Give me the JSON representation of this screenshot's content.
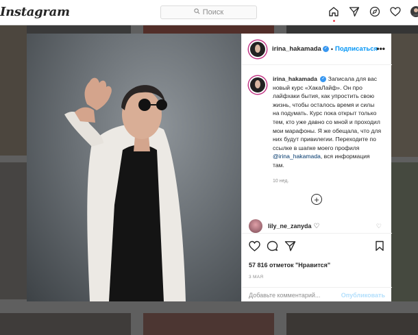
{
  "app": {
    "logo": "Instagram"
  },
  "header": {
    "search": {
      "placeholder": "Поиск"
    },
    "icons": [
      "home-icon",
      "direct-icon",
      "explore-icon",
      "activity-heart-icon",
      "profile-avatar"
    ]
  },
  "post": {
    "author": {
      "username": "irina_hakamada",
      "verified": true,
      "follow_label": "Подписаться",
      "separator": "•"
    },
    "more_label": "•••",
    "caption": {
      "username": "irina_hakamada",
      "text": "Записала для вас новый курс «ХакаЛайф». Он про лайфхаки бытия, как упростить свою жизнь, чтобы осталось время и силы на подумать. Курс пока открыт только тем, кто уже давно со мной и проходил мои марафоны. Я же обещала, что для них будут привилегии. Переходите по ссылке в шапке моего профиля",
      "mention": "@irina_hakamada",
      "text_after": ", вся информация там.",
      "age": "10 нед."
    },
    "load_more_icon": "plus-circle-icon",
    "comments": [
      {
        "username": "lily_ne_zanyda",
        "text": "♡"
      }
    ],
    "likes_text": "57 816 отметок \"Нравится\"",
    "date": "3 МАЯ",
    "add_comment": {
      "placeholder": "Добавьте комментарий...",
      "publish_label": "Опубликовать"
    }
  },
  "colors": {
    "accent": "#0095f6",
    "verified": "#3897f0",
    "text": "#262626",
    "muted": "#8e8e8e",
    "overlay": "rgba(0,0,0,0.62)"
  }
}
